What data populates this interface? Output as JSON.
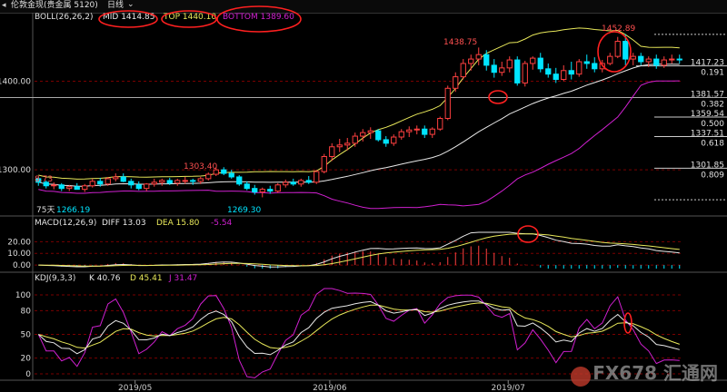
{
  "header": {
    "title": "伦敦金现(贵金属 5120)",
    "period": "日线",
    "nav_left": "◂",
    "dropdown": "⌄"
  },
  "boll": {
    "label": "BOLL(26,26,2)",
    "mid": "MID 1414.85",
    "top": "TOP 1440.10",
    "bottom": "BOTTOM 1389.60"
  },
  "macd": {
    "label": "MACD(12,26,9)",
    "diff": "DIFF 13.03",
    "dea": "DEA 15.80",
    "hist": "-5.54"
  },
  "kdj": {
    "label": "KDJ(9,3,3)",
    "k": "K 40.76",
    "d": "D 45.41",
    "j": "J 31.47"
  },
  "colors": {
    "up": "#ff4040",
    "down": "#00e5ff",
    "mid_line": "#e8e8e8",
    "top_line": "#e8e85a",
    "bottom_line": "#d020d0",
    "grid": "#7a0000",
    "annotation": "#ff5050"
  },
  "annotations": {
    "left_edge": "8.73",
    "p1303": "1303.40",
    "p1269": "1269.30",
    "p1438": "1438.75",
    "p1452": "1452.89",
    "low_label": "75天",
    "low_value": "1266.19"
  },
  "right_levels": [
    {
      "price": "1417.23",
      "ratio": "0.191"
    },
    {
      "price": "1381.57",
      "ratio": "0.382"
    },
    {
      "price": "1359.54",
      "ratio": "0.500"
    },
    {
      "price": "1337.51",
      "ratio": "0.618"
    },
    {
      "price": "1301.85",
      "ratio": "0.809"
    }
  ],
  "chart_data": {
    "type": "candlestick",
    "price_axis": {
      "ticks": [
        "1400.00",
        "1300.00"
      ],
      "ylim": [
        1250,
        1465
      ]
    },
    "macd_axis": {
      "ticks": [
        "20.00",
        "10.00",
        "0.00"
      ],
      "ylim": [
        -5,
        30
      ]
    },
    "kdj_axis": {
      "ticks": [
        "100",
        "80",
        "50",
        "20",
        "0"
      ],
      "ylim": [
        -5,
        110
      ]
    },
    "x_labels": [
      "2019/05",
      "2019/06",
      "2019/07"
    ],
    "candles": [
      [
        1290,
        1292,
        1282,
        1286
      ],
      [
        1286,
        1288,
        1279,
        1282
      ],
      [
        1282,
        1286,
        1278,
        1283
      ],
      [
        1283,
        1285,
        1276,
        1279
      ],
      [
        1279,
        1283,
        1276,
        1281
      ],
      [
        1281,
        1285,
        1278,
        1278
      ],
      [
        1278,
        1284,
        1275,
        1282
      ],
      [
        1282,
        1290,
        1280,
        1287
      ],
      [
        1287,
        1291,
        1281,
        1284
      ],
      [
        1284,
        1292,
        1282,
        1290
      ],
      [
        1290,
        1296,
        1287,
        1292
      ],
      [
        1292,
        1296,
        1286,
        1287
      ],
      [
        1287,
        1290,
        1279,
        1283
      ],
      [
        1283,
        1287,
        1277,
        1279
      ],
      [
        1279,
        1285,
        1276,
        1284
      ],
      [
        1284,
        1290,
        1281,
        1286
      ],
      [
        1286,
        1290,
        1282,
        1288
      ],
      [
        1288,
        1291,
        1283,
        1285
      ],
      [
        1285,
        1290,
        1282,
        1288
      ],
      [
        1288,
        1292,
        1284,
        1288
      ],
      [
        1288,
        1290,
        1283,
        1287
      ],
      [
        1287,
        1292,
        1284,
        1290
      ],
      [
        1290,
        1297,
        1288,
        1295
      ],
      [
        1295,
        1303,
        1293,
        1300
      ],
      [
        1300,
        1303,
        1294,
        1296
      ],
      [
        1296,
        1300,
        1290,
        1292
      ],
      [
        1292,
        1294,
        1282,
        1284
      ],
      [
        1284,
        1287,
        1277,
        1279
      ],
      [
        1279,
        1283,
        1272,
        1275
      ],
      [
        1275,
        1280,
        1269,
        1278
      ],
      [
        1278,
        1282,
        1273,
        1276
      ],
      [
        1276,
        1285,
        1274,
        1283
      ],
      [
        1283,
        1289,
        1280,
        1286
      ],
      [
        1286,
        1290,
        1282,
        1284
      ],
      [
        1284,
        1290,
        1281,
        1288
      ],
      [
        1288,
        1293,
        1284,
        1286
      ],
      [
        1286,
        1300,
        1284,
        1298
      ],
      [
        1298,
        1318,
        1296,
        1315
      ],
      [
        1315,
        1330,
        1310,
        1326
      ],
      [
        1326,
        1335,
        1320,
        1328
      ],
      [
        1328,
        1336,
        1322,
        1330
      ],
      [
        1330,
        1342,
        1326,
        1338
      ],
      [
        1338,
        1346,
        1332,
        1342
      ],
      [
        1342,
        1348,
        1335,
        1344
      ],
      [
        1344,
        1346,
        1332,
        1334
      ],
      [
        1334,
        1338,
        1326,
        1330
      ],
      [
        1330,
        1340,
        1327,
        1337
      ],
      [
        1337,
        1346,
        1334,
        1343
      ],
      [
        1343,
        1349,
        1337,
        1345
      ],
      [
        1345,
        1350,
        1340,
        1346
      ],
      [
        1346,
        1350,
        1336,
        1340
      ],
      [
        1340,
        1348,
        1336,
        1346
      ],
      [
        1346,
        1360,
        1344,
        1358
      ],
      [
        1358,
        1395,
        1356,
        1392
      ],
      [
        1392,
        1410,
        1388,
        1405
      ],
      [
        1405,
        1425,
        1402,
        1420
      ],
      [
        1420,
        1430,
        1412,
        1425
      ],
      [
        1425,
        1438,
        1418,
        1430
      ],
      [
        1430,
        1435,
        1412,
        1418
      ],
      [
        1418,
        1425,
        1404,
        1410
      ],
      [
        1410,
        1422,
        1406,
        1415
      ],
      [
        1415,
        1428,
        1410,
        1424
      ],
      [
        1424,
        1428,
        1395,
        1398
      ],
      [
        1398,
        1423,
        1394,
        1420
      ],
      [
        1420,
        1428,
        1413,
        1426
      ],
      [
        1426,
        1432,
        1410,
        1414
      ],
      [
        1414,
        1420,
        1404,
        1408
      ],
      [
        1408,
        1415,
        1398,
        1402
      ],
      [
        1402,
        1418,
        1400,
        1412
      ],
      [
        1412,
        1422,
        1402,
        1408
      ],
      [
        1408,
        1425,
        1405,
        1422
      ],
      [
        1422,
        1430,
        1414,
        1420
      ],
      [
        1420,
        1427,
        1410,
        1414
      ],
      [
        1414,
        1424,
        1410,
        1420
      ],
      [
        1420,
        1432,
        1418,
        1428
      ],
      [
        1428,
        1450,
        1426,
        1445
      ],
      [
        1445,
        1453,
        1418,
        1425
      ],
      [
        1425,
        1432,
        1418,
        1428
      ],
      [
        1428,
        1432,
        1418,
        1422
      ],
      [
        1422,
        1428,
        1416,
        1425
      ],
      [
        1425,
        1430,
        1414,
        1418
      ],
      [
        1418,
        1428,
        1415,
        1424
      ],
      [
        1424,
        1430,
        1420,
        1425
      ],
      [
        1425,
        1430,
        1420,
        1424
      ]
    ]
  }
}
